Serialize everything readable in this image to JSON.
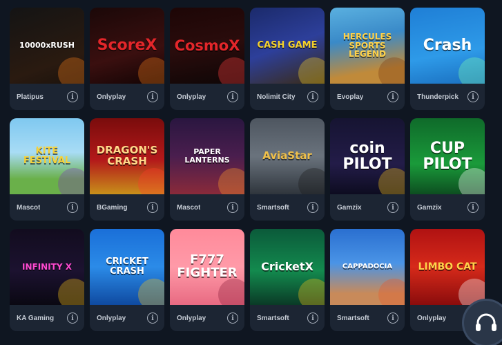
{
  "games": [
    {
      "title": "10000xRUSH",
      "provider": "Platipus",
      "bg": "linear-gradient(160deg,#141414,#2a1a10 70%,#1a120c)",
      "color": "#ffffff",
      "accent": "#f07a1a",
      "size": "11px"
    },
    {
      "title": "ScoreX",
      "provider": "Onlyplay",
      "bg": "linear-gradient(165deg,#1b0808,#3a0f0f 60%,#120404)",
      "color": "#e3262a",
      "accent": "#f07a1a",
      "size": "22px"
    },
    {
      "title": "CosmoX",
      "provider": "Onlyplay",
      "bg": "linear-gradient(170deg,#1d0606,#2a0c0c 50%,#0e0606)",
      "color": "#e3262a",
      "accent": "#ff4040",
      "size": "21px"
    },
    {
      "title": "CASH GAME",
      "provider": "Nolimit City",
      "bg": "linear-gradient(160deg,#1b2a6b,#2d3f9a 50%,#3a2a12)",
      "color": "#f5d12a",
      "accent": "#f5d12a",
      "size": "13px"
    },
    {
      "title": "HERCULES SPORTS LEGEND",
      "provider": "Evoplay",
      "bg": "linear-gradient(170deg,#5ab0e0,#3a8ac8 40%,#c08a3a 80%)",
      "color": "#ffd24a",
      "accent": "#7a3a10",
      "size": "12px"
    },
    {
      "title": "Crash",
      "provider": "Thunderpick",
      "bg": "linear-gradient(170deg,#1f7fd6,#2e9ae8 60%,#1a6fbf)",
      "color": "#ffffff",
      "accent": "#7fffb0",
      "size": "22px"
    },
    {
      "title": "KITE FESTIVAL",
      "provider": "Mascot",
      "bg": "linear-gradient(180deg,#7fc8f0,#a8dcf5 45%,#6ab04a 80%)",
      "color": "#f7d23a",
      "accent": "#7a3ab0",
      "size": "13px"
    },
    {
      "title": "DRAGON'S CRASH",
      "provider": "BGaming",
      "bg": "linear-gradient(180deg,#7a0c0c,#b3191a 55%,#c8901a)",
      "color": "#ffd98a",
      "accent": "#ff3b2a",
      "size": "15px"
    },
    {
      "title": "PAPER LANTERNS",
      "provider": "Mascot",
      "bg": "linear-gradient(180deg,#2a1640,#4a1e4e 50%,#8a2a3a)",
      "color": "#ffffff",
      "accent": "#ff9a2a",
      "size": "11px"
    },
    {
      "title": "AviaStar",
      "provider": "Smartsoft",
      "bg": "linear-gradient(180deg,#4e5660,#6a737d 50%,#2f353c)",
      "color": "#f0c04a",
      "accent": "#1a1a1a",
      "size": "15px"
    },
    {
      "title": "coin PILOT",
      "provider": "Gamzix",
      "bg": "linear-gradient(180deg,#161432,#231c48 60%,#0d0c20)",
      "color": "#ffffff",
      "accent": "#f5c21a",
      "size": "22px"
    },
    {
      "title": "CUP PILOT",
      "provider": "Gamzix",
      "bg": "linear-gradient(180deg,#0f6a2a,#1a9a3a 60%,#0d4e20)",
      "color": "#ffffff",
      "accent": "#ffffff",
      "size": "22px"
    },
    {
      "title": "INFINITY X",
      "provider": "KA Gaming",
      "bg": "linear-gradient(180deg,#120c1e,#1c1230 55%,#0a0812)",
      "color": "#ff4ad0",
      "accent": "#f5c21a",
      "size": "12px"
    },
    {
      "title": "CRICKET CRASH",
      "provider": "Onlyplay",
      "bg": "linear-gradient(180deg,#1a6fd8,#2b8be8 50%,#0f4aa0)",
      "color": "#ffffff",
      "accent": "#f5c21a",
      "size": "13px"
    },
    {
      "title": "F777 FIGHTER",
      "provider": "Onlyplay",
      "bg": "linear-gradient(180deg,#ff8a9a,#ff9aa8 50%,#e86a82)",
      "color": "#ffffff",
      "accent": "#8a1e3a",
      "size": "18px"
    },
    {
      "title": "CricketX",
      "provider": "Smartsoft",
      "bg": "linear-gradient(180deg,#0b5a3a,#138a4e 55%,#0a3a26)",
      "color": "#ffffff",
      "accent": "#f5c21a",
      "size": "16px"
    },
    {
      "title": "CAPPADOCIA",
      "provider": "Smartsoft",
      "bg": "linear-gradient(180deg,#2a6fd0,#4a94e6 45%,#c88a5a 85%)",
      "color": "#ffffff",
      "accent": "#e85a2a",
      "size": "10px"
    },
    {
      "title": "LIMBO CAT",
      "provider": "Onlyplay",
      "bg": "linear-gradient(180deg,#b01212,#d62a1a 50%,#8a0c0c)",
      "color": "#ffd24a",
      "accent": "#ffffff",
      "size": "14px"
    }
  ],
  "info_label": "i",
  "support_icon": "headset-icon"
}
